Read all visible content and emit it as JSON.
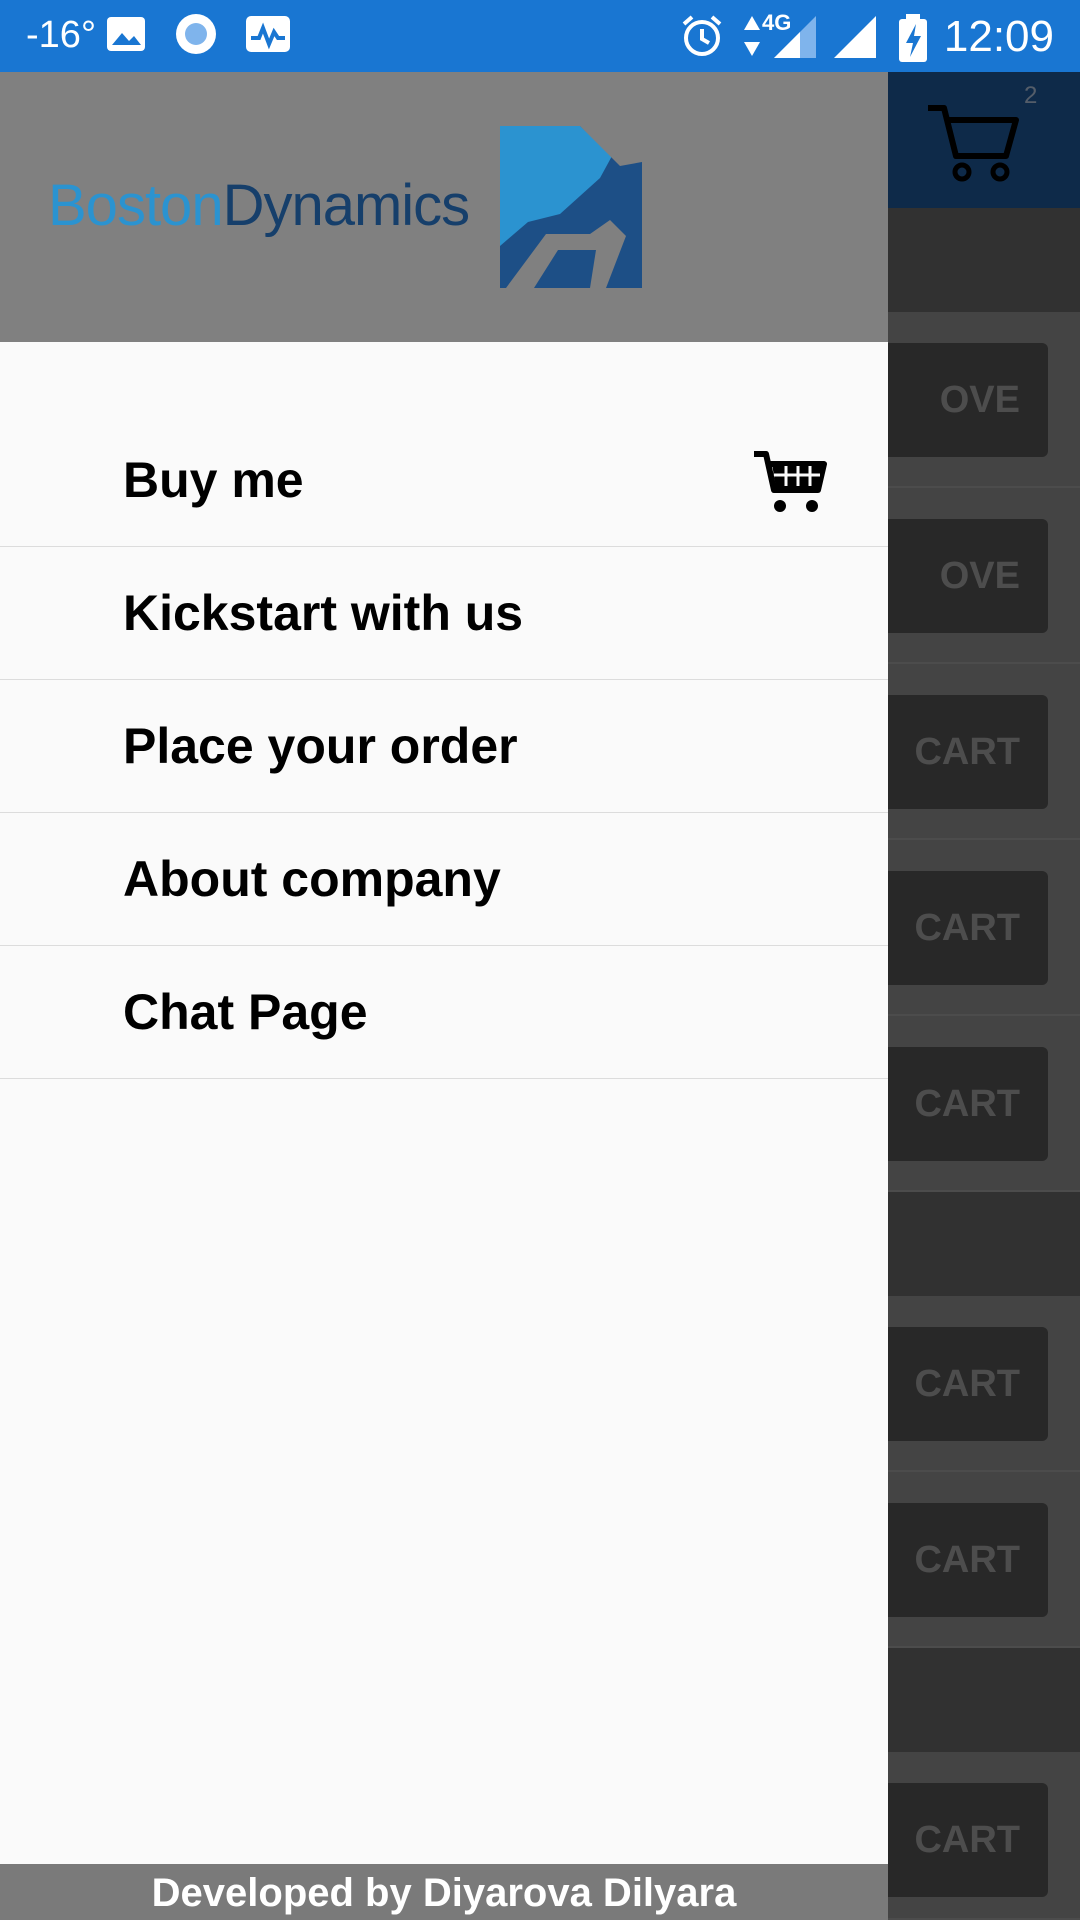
{
  "status_bar": {
    "temperature": "-16°",
    "time": "12:09",
    "network": "4G",
    "icons": [
      "image-icon",
      "circle-notification-icon",
      "activity-icon",
      "alarm-icon",
      "data-arrows-icon",
      "signal-icon",
      "signal-icon-2",
      "battery-charging-icon"
    ]
  },
  "background_app": {
    "cart_count": "2",
    "buttons": [
      "OVE",
      "OVE",
      "CART",
      "CART",
      "CART",
      "CART",
      "CART",
      "CART"
    ]
  },
  "drawer": {
    "brand": {
      "part1": "Boston",
      "part2": "Dynamics"
    },
    "menu": [
      {
        "label": "Buy me",
        "icon": "shopping-cart-icon"
      },
      {
        "label": "Kickstart with us"
      },
      {
        "label": "Place your order"
      },
      {
        "label": "About company"
      },
      {
        "label": "Chat Page"
      }
    ],
    "footer": "Developed by Diyarova Dilyara"
  },
  "colors": {
    "status_bar": "#1976d2",
    "brand_light": "#2b93d0",
    "brand_dark": "#163f6b",
    "drawer_bg": "#fafafa",
    "header_bg": "#808080"
  }
}
